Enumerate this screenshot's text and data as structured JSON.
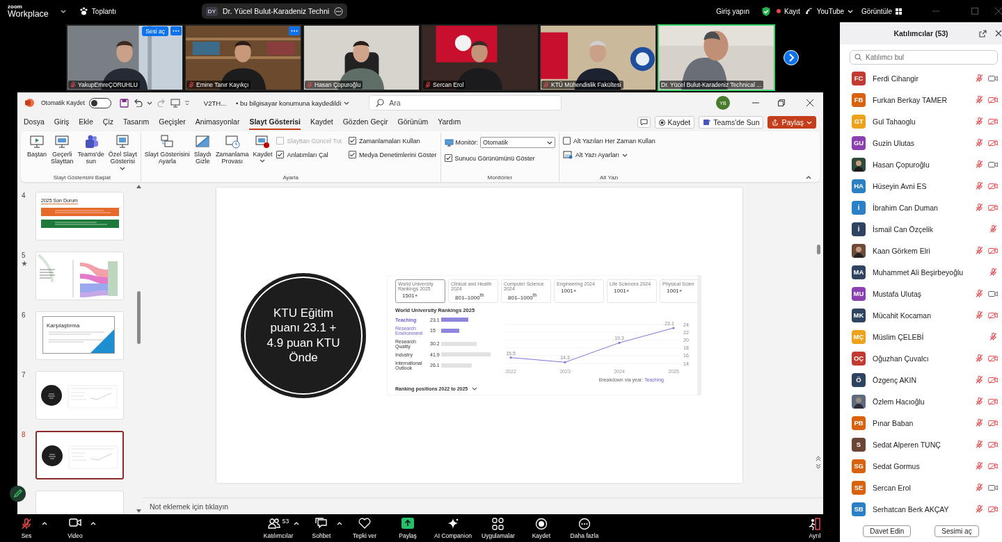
{
  "top_bar": {
    "logo_top": "zoom",
    "logo_bottom": "Workplace",
    "meeting_menu": "Toplantı",
    "host_initials": "DY",
    "host_name": "Dr. Yücel Bulut-Karadeniz Techni",
    "sign_in": "Giriş yapın",
    "record": "Kayıt",
    "recording": true,
    "stream": "YouTube",
    "view": "Görüntüle"
  },
  "video_tiles": [
    {
      "name": "YakupEmreÇORUHLU",
      "muted": true,
      "active": false,
      "unmute_button": "Sesi aç",
      "menu": true
    },
    {
      "name": "Emine Tanır Kayıkçı",
      "muted": true,
      "active": false,
      "menu": true
    },
    {
      "name": "Hasan Çopuroğlu",
      "muted": true,
      "active": false,
      "menu": false
    },
    {
      "name": "Sercan Erol",
      "muted": true,
      "active": false,
      "menu": false
    },
    {
      "name": "KTÜ Mühendislik Fakültesi",
      "muted": true,
      "active": false,
      "menu": false
    },
    {
      "name": "Dr. Yücel Bulut-Karadeniz Technical ...",
      "muted": false,
      "active": true,
      "menu": false
    }
  ],
  "powerpoint": {
    "title_bar": {
      "autosave_label": "Otomatik Kaydet",
      "autosave_on": false,
      "file_name": "V2TH...",
      "save_status": "• bu bilgisayar konumuna kaydedildi",
      "search_placeholder": "Ara",
      "user_initials": "YB"
    },
    "tabs": [
      {
        "label": "Dosya",
        "selected": false
      },
      {
        "label": "Giriş",
        "selected": false
      },
      {
        "label": "Ekle",
        "selected": false
      },
      {
        "label": "Çiz",
        "selected": false
      },
      {
        "label": "Tasarım",
        "selected": false
      },
      {
        "label": "Geçişler",
        "selected": false
      },
      {
        "label": "Animasyonlar",
        "selected": false
      },
      {
        "label": "Slayt Gösterisi",
        "selected": true
      },
      {
        "label": "Kaydet",
        "selected": false
      },
      {
        "label": "Gözden Geçir",
        "selected": false
      },
      {
        "label": "Görünüm",
        "selected": false
      },
      {
        "label": "Yardım",
        "selected": false
      }
    ],
    "tab_actions": {
      "record": "Kaydet",
      "teams": "Teams'de Sun",
      "share": "Paylaş"
    },
    "ribbon": [
      {
        "label": "Slayt Gösterisini Başlat",
        "items": [
          {
            "kind": "large",
            "label": "Baştan",
            "menu": false
          },
          {
            "kind": "large",
            "label": "Geçerli\nSlayttan",
            "menu": false
          },
          {
            "kind": "large",
            "label": "Teams'de\nsun",
            "menu": false
          },
          {
            "kind": "large",
            "label": "Özel Slayt\nGösterisi",
            "menu": true
          }
        ]
      },
      {
        "label": "Ayarla",
        "items": [
          {
            "kind": "large",
            "label": "Slayt Gösterisini\nAyarla",
            "menu": false
          },
          {
            "kind": "large",
            "label": "Slaydı\nGizle",
            "menu": false
          },
          {
            "kind": "large",
            "label": "Zamanlama\nProvası",
            "menu": false
          },
          {
            "kind": "large",
            "label": "Kaydet",
            "menu": true
          },
          {
            "kind": "check",
            "label": "Slayttan Güncel Tut",
            "checked": false,
            "disabled": true
          },
          {
            "kind": "check",
            "label": "Anlatımları Çal",
            "checked": true,
            "disabled": false
          },
          {
            "kind": "check",
            "label": "Zamanlamaları Kullan",
            "checked": true,
            "disabled": false
          },
          {
            "kind": "check",
            "label": "Medya Denetimlerini Göster",
            "checked": true,
            "disabled": false
          }
        ]
      },
      {
        "label": "Monitörler",
        "items": [
          {
            "kind": "select",
            "label": "Monitör:",
            "value": "Otomatik"
          },
          {
            "kind": "check",
            "label": "Sunucu Görünümünü Göster",
            "checked": true,
            "disabled": false
          }
        ]
      },
      {
        "label": "Alt Yazı",
        "items": [
          {
            "kind": "check",
            "label": "Alt Yazıları Her Zaman Kullan",
            "checked": false,
            "disabled": false
          },
          {
            "kind": "small",
            "label": "Alt Yazı Ayarları",
            "menu": true
          }
        ]
      }
    ],
    "thumbnails": [
      {
        "number": "4",
        "kind": "status",
        "title": "2025 Son Durum",
        "starred": false,
        "selected": false
      },
      {
        "number": "5",
        "kind": "sankey",
        "starred": true,
        "selected": false
      },
      {
        "number": "6",
        "kind": "title",
        "title": "Karşılaştırma",
        "starred": false,
        "selected": false
      },
      {
        "number": "7",
        "kind": "circle",
        "starred": false,
        "selected": false
      },
      {
        "number": "8",
        "kind": "circle",
        "starred": false,
        "selected": true
      },
      {
        "kind": "blank",
        "starred": false,
        "selected": false
      }
    ],
    "slide": {
      "circle_text": "KTU Eğitim puanı 23.1 + 4.9 puan KTU Önde",
      "ranking_cards": [
        {
          "label": "World University Rankings 2025",
          "value": "1501+",
          "selected": true
        },
        {
          "label": "Clinical and Health 2024",
          "value": "801–1000$^{th}$",
          "selected": false
        },
        {
          "label": "Computer Science 2024",
          "value": "801–1000$^{th}$",
          "selected": false
        },
        {
          "label": "Engineering 2024",
          "value": "1001+",
          "selected": false
        },
        {
          "label": "Life Sciences 2024",
          "value": "1001+",
          "selected": false
        },
        {
          "label": "Physical Scien",
          "value": "1001+",
          "selected": false
        }
      ],
      "chart_heading": "World University Rankings 2025",
      "pillars": [
        {
          "label": "Teaching",
          "value": "23.1",
          "selected": true,
          "color": "#8e86dc"
        },
        {
          "label": "Research Environment",
          "value": "15",
          "selected": false,
          "color": "#8e86dc"
        },
        {
          "label": "Research Quality",
          "value": "30.2",
          "selected": false,
          "color": "#e2e2e2"
        },
        {
          "label": "Industry",
          "value": "41.9",
          "selected": false,
          "color": "#e2e2e2"
        },
        {
          "label": "International Outlook",
          "value": "26.1",
          "selected": false,
          "color": "#e2e2e2"
        }
      ],
      "chart_data": {
        "type": "line",
        "categories": [
          "2022",
          "2023",
          "2024",
          "2025"
        ],
        "series": [
          {
            "name": "Teaching",
            "color": "#7f76d6",
            "values": [
              15.5,
              14.3,
              19.3,
              23.1
            ]
          }
        ],
        "ylim": [
          14,
          24
        ],
        "yticks": [
          14,
          16,
          18,
          20,
          22,
          24
        ],
        "grid": true,
        "data_labels": true
      },
      "legend_label": "Breakdown via year:",
      "footer": "Ranking positions 2022 to 2025"
    },
    "notes_placeholder": "Not eklemek için tıklayın"
  },
  "participants": {
    "title": "Katılımcılar (53)",
    "search_placeholder": "Katılımcı bul",
    "people": [
      {
        "name": "Ferdi Cihangir",
        "kind": "initials",
        "initials": "FC",
        "color": "#c23b32",
        "muted": true,
        "camera_shown": true,
        "video_on": true
      },
      {
        "name": "Furkan Berkay TAMER",
        "kind": "initials",
        "initials": "FB",
        "color": "#d9620f",
        "muted": true,
        "camera_shown": true,
        "video_on": false
      },
      {
        "name": "Gul Tahaoglu",
        "kind": "initials",
        "initials": "GT",
        "color": "#eda21b",
        "muted": true,
        "camera_shown": true,
        "video_on": false
      },
      {
        "name": "Guzin Ulutas",
        "kind": "initials",
        "initials": "GU",
        "color": "#8c3fb0",
        "muted": true,
        "camera_shown": true,
        "video_on": false
      },
      {
        "name": "Hasan Çopuroğlu",
        "muted": true,
        "camera_shown": true,
        "video_on": true
      },
      {
        "name": "Hüseyin Avni ES",
        "kind": "initials",
        "initials": "HA",
        "color": "#2b7fc4",
        "muted": true,
        "camera_shown": true,
        "video_on": false
      },
      {
        "name": "İbrahim Can Duman",
        "kind": "initials",
        "initials": "İ",
        "color": "#2b7fc4",
        "muted": true,
        "camera_shown": true,
        "video_on": false
      },
      {
        "name": "İsmail Can Özçelik",
        "kind": "initials",
        "initials": "İ",
        "color": "#2f4460",
        "muted": true,
        "camera_shown": false
      },
      {
        "name": "Kaan Görkem Elri",
        "muted": true,
        "camera_shown": true,
        "video_on": false
      },
      {
        "name": "Muhammet Ali Beşirbeyoğlu",
        "kind": "initials",
        "initials": "MA",
        "color": "#2f4460",
        "muted": true,
        "camera_shown": false
      },
      {
        "name": "Mustafa Ulutaş",
        "kind": "initials",
        "initials": "MU",
        "color": "#8c3fb0",
        "muted": true,
        "camera_shown": true,
        "video_on": true
      },
      {
        "name": "Mücahit Kocaman",
        "kind": "initials",
        "initials": "MK",
        "color": "#2f4460",
        "muted": true,
        "camera_shown": true,
        "video_on": false
      },
      {
        "name": "Müslim ÇELEBİ",
        "kind": "initials",
        "initials": "MÇ",
        "color": "#eda21b",
        "muted": true,
        "camera_shown": false
      },
      {
        "name": "Oğuzhan Çuvalcı",
        "kind": "initials",
        "initials": "OÇ",
        "color": "#c23b32",
        "muted": true,
        "camera_shown": true,
        "video_on": false
      },
      {
        "name": "Özgenç AKIN",
        "kind": "initials",
        "initials": "Ö",
        "color": "#2f4460",
        "muted": true,
        "camera_shown": true,
        "video_on": false
      },
      {
        "name": "Özlem Hacıoğlu",
        "muted": true,
        "camera_shown": true,
        "video_on": false
      },
      {
        "name": "Pınar Baban",
        "kind": "initials",
        "initials": "PB",
        "color": "#d9620f",
        "muted": true,
        "camera_shown": true,
        "video_on": false
      },
      {
        "name": "Sedat Alperen TUNÇ",
        "kind": "initials",
        "initials": "S",
        "color": "#6b4535",
        "muted": true,
        "camera_shown": true,
        "video_on": false
      },
      {
        "name": "Sedat Gormus",
        "kind": "initials",
        "initials": "SG",
        "color": "#d9620f",
        "muted": true,
        "camera_shown": true,
        "video_on": false
      },
      {
        "name": "Sercan Erol",
        "kind": "initials",
        "initials": "SE",
        "color": "#d9620f",
        "muted": true,
        "camera_shown": true,
        "video_on": true
      },
      {
        "name": "Serhatcan Berk AKÇAY",
        "kind": "initials",
        "initials": "SB",
        "color": "#2b7fc4",
        "muted": true,
        "camera_shown": true,
        "video_on": false
      }
    ],
    "buttons": [
      "Davet Edin",
      "Sesimi aç"
    ]
  },
  "toolbar": [
    {
      "label": "Ses",
      "menu": true,
      "muted": true
    },
    {
      "label": "Video",
      "menu": true
    },
    {
      "label": "Katılımcılar",
      "menu": true,
      "count": "53"
    },
    {
      "label": "Sohbet",
      "menu": true
    },
    {
      "label": "Tepki ver",
      "menu": false
    },
    {
      "label": "Paylaş",
      "menu": false
    },
    {
      "label": "AI Companion",
      "menu": false
    },
    {
      "label": "Uygulamalar",
      "menu": false
    },
    {
      "label": "Kaydet",
      "menu": false
    },
    {
      "label": "Daha fazla",
      "menu": false
    },
    {
      "label": "Ayrıl",
      "menu": false
    }
  ]
}
